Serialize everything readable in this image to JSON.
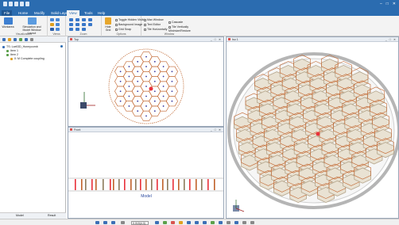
{
  "app": {
    "window_controls": [
      "–",
      "□",
      "✕"
    ]
  },
  "ribbon": {
    "tabs": [
      "File",
      "Home",
      "Modify",
      "Solid Layer",
      "View",
      "Tools",
      "Help"
    ],
    "active_tab": "View",
    "groups": {
      "visualization": {
        "label": "Visualization",
        "buttons": [
          "Workarea",
          "Simulation and Model Window Layout"
        ]
      },
      "views": {
        "label": "Views"
      },
      "zoom": {
        "label": "Zoom"
      },
      "options": {
        "label": "Options",
        "hide_grid": "Hide Grid",
        "items": [
          "Toggle Hidden Visible",
          "Background Image",
          "Grid Snap"
        ]
      },
      "window": {
        "label": "Window",
        "items": [
          "Max Window",
          "Text Editor",
          "Tile Horizontally",
          "Cascade",
          "Tile Vertically",
          "Minimize/Restore"
        ]
      }
    }
  },
  "tree": {
    "items": [
      "TS: Lcell3D_Honeycomb",
      "Item 1",
      "Item 2",
      "0: M Complete coupling"
    ]
  },
  "left_tabs": [
    "Model",
    "Result"
  ],
  "views": {
    "top_left": {
      "title": "Top"
    },
    "bottom_left": {
      "title": "Front"
    },
    "right": {
      "title": "Iso 1",
      "controls": "_ □ ✕"
    },
    "model_label": "Model",
    "controls": "_ □ ✕"
  },
  "statusbar": {
    "value": "0.015(4.0)"
  },
  "colors": {
    "accent": "#2b6cb0",
    "cell": "#c0622a",
    "wall": "#b5a68c",
    "node": "#3a3aa0",
    "highlight": "#e8303a"
  }
}
